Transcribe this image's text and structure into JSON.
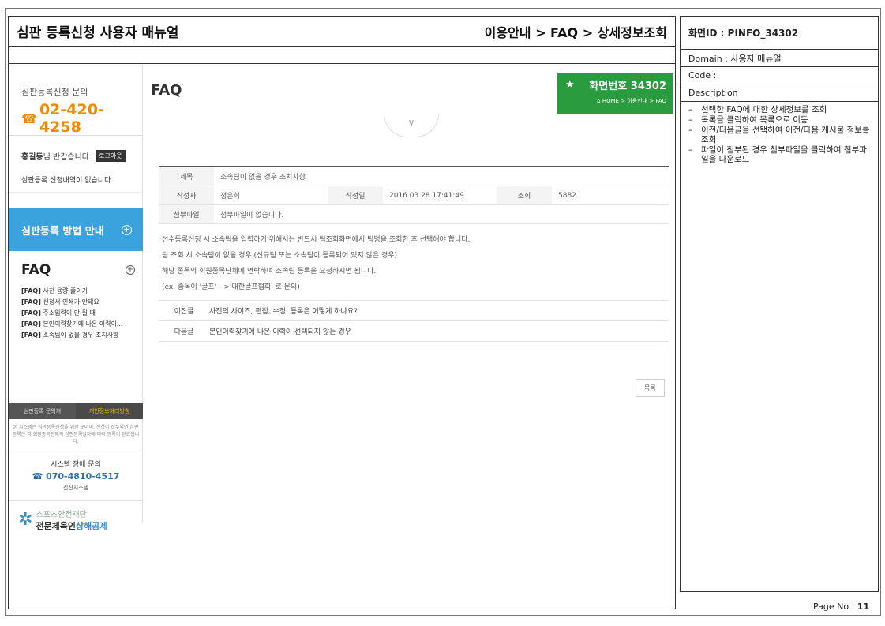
{
  "header": {
    "doc_title": "심판 등록신청 사용자 매뉴얼",
    "path": "이용안내 > FAQ > 상세정보조회"
  },
  "sidebar": {
    "contact_label": "심판등록신청 문의",
    "contact_phone": "02-420-4258",
    "user_name": "홍길동",
    "greeting_suffix": "님 반갑습니다.",
    "logout_label": "로그아웃",
    "no_history": "심판등록 신청내역이 없습니다.",
    "guide_label": "심판등록 방법 안내",
    "faq_title": "FAQ",
    "faq_items": [
      {
        "tag": "[FAQ]",
        "text": "사진 용량 줄이기"
      },
      {
        "tag": "[FAQ]",
        "text": "신청서 인쇄가 안돼요"
      },
      {
        "tag": "[FAQ]",
        "text": "주소입력이 안 될 때"
      },
      {
        "tag": "[FAQ]",
        "text": "본인이력찾기에 나온 이력이..."
      },
      {
        "tag": "[FAQ]",
        "text": "소속팀이 없을 경우 조치사항"
      }
    ],
    "footer_tab_inquiry": "심판등록 문의처",
    "footer_tab_privacy": "개인정보처리방침",
    "notice": "본 시스템은 심판등록신청을 위한 곳이며, 신청이 접수되면 심판등록은 각 회원종목단체의 심판등록절차에 따라 등록이 완료됩니다.",
    "system_label": "시스템 장애 문의",
    "system_phone": "070-4810-4517",
    "system_company": "진진시스템",
    "logo_line1": "스포츠안전재단",
    "logo_line2a": "전문체육인",
    "logo_line2b": "상해공제"
  },
  "content": {
    "page_title": "FAQ",
    "screen_number": "화면번호 34302",
    "breadcrumb": "HOME > 이용안내 > FAQ",
    "labels": {
      "subject": "제목",
      "author": "작성자",
      "date": "작성일",
      "views": "조회",
      "attachment": "첨부파일",
      "prev": "이전글",
      "next": "다음글"
    },
    "subject": "소속팀이 없을 경우 조치사항",
    "author": "정은희",
    "date": "2016.03.28 17:41:49",
    "views": "5882",
    "attachment": "첨부파일이 없습니다.",
    "body_lines": [
      "선수등록신청 시 소속팀을 입력하기 위해서는 반드시 팀조회화면에서 팀명을 조회한 후 선택해야 합니다.",
      "팀 조회 시 소속팀이 없을 경우 (신규팀 또는 소속팀이 등록되어 있지 않은 경우)",
      "해당 종목의 회원종목단체에 연락하여 소속팀 등록을 요청하시면 됩니다.",
      "(ex. 종목이 '골프' -->'대한골프협회' 로 문의)"
    ],
    "prev_title": "사진의 사이즈, 편집, 수정, 등록은 어떻게 하나요?",
    "next_title": "본인이력찾기에 나온 이력이 선택되지 않는 경우",
    "list_button": "목록"
  },
  "info": {
    "screen_id": "화면ID : PINFO_34302",
    "domain": "Domain : 사용자 매뉴얼",
    "code": "Code :",
    "description_label": "Description",
    "descriptions": [
      "선택한 FAQ에 대한 상세정보를 조회",
      "목록을 클릭하여 목록으로 이동",
      "이전/다음글을 선택하여 이전/다음 게시물 정보를 조회",
      "파일이 첨부된 경우 첨부파일을 클릭하여 첨부파일을 다운로드"
    ],
    "page_no_label": "Page No :",
    "page_no": "11"
  },
  "colors": {
    "accent_blue": "#3aa3dd",
    "badge_green": "#2a9b3e",
    "phone_orange": "#f08a00"
  }
}
